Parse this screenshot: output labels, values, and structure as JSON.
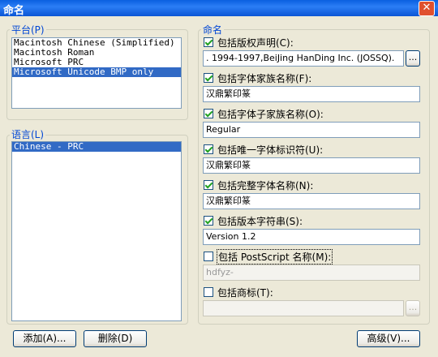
{
  "window": {
    "title": "命名",
    "close_glyph": "✕"
  },
  "platform": {
    "label": "平台(P)",
    "items": [
      {
        "text": "Macintosh Chinese (Simplified)",
        "selected": false
      },
      {
        "text": "Macintosh Roman",
        "selected": false
      },
      {
        "text": "Microsoft PRC",
        "selected": false
      },
      {
        "text": "Microsoft Unicode BMP only",
        "selected": true
      }
    ]
  },
  "language": {
    "label": "语言(L)",
    "items": [
      {
        "text": "Chinese - PRC",
        "selected": true
      }
    ]
  },
  "buttons": {
    "add": "添加(A)...",
    "delete": "删除(D)",
    "advanced": "高级(V)..."
  },
  "naming": {
    "label": "命名",
    "fields": [
      {
        "label": "包括版权声明(C):",
        "checked": true,
        "value": ". 1994-1997,BeiJing HanDing Inc. (JOSSQ).",
        "enabled": true,
        "browse": "..."
      },
      {
        "label": "包括字体家族名称(F):",
        "checked": true,
        "value": "汉鼎繁印篆",
        "enabled": true
      },
      {
        "label": "包括字体子家族名称(O):",
        "checked": true,
        "value": "Regular",
        "enabled": true
      },
      {
        "label": "包括唯一字体标识符(U):",
        "checked": true,
        "value": "汉鼎繁印篆",
        "enabled": true
      },
      {
        "label": "包括完整字体名称(N):",
        "checked": true,
        "value": "汉鼎繁印篆",
        "enabled": true
      },
      {
        "label": "包括版本字符串(S):",
        "checked": true,
        "value": "Version 1.2",
        "enabled": true
      },
      {
        "label": "包括 PostScript 名称(M):",
        "checked": false,
        "value": "hdfyz-",
        "enabled": false
      },
      {
        "label": "包括商标(T):",
        "checked": false,
        "value": "",
        "enabled": false,
        "browse": "..."
      }
    ]
  }
}
